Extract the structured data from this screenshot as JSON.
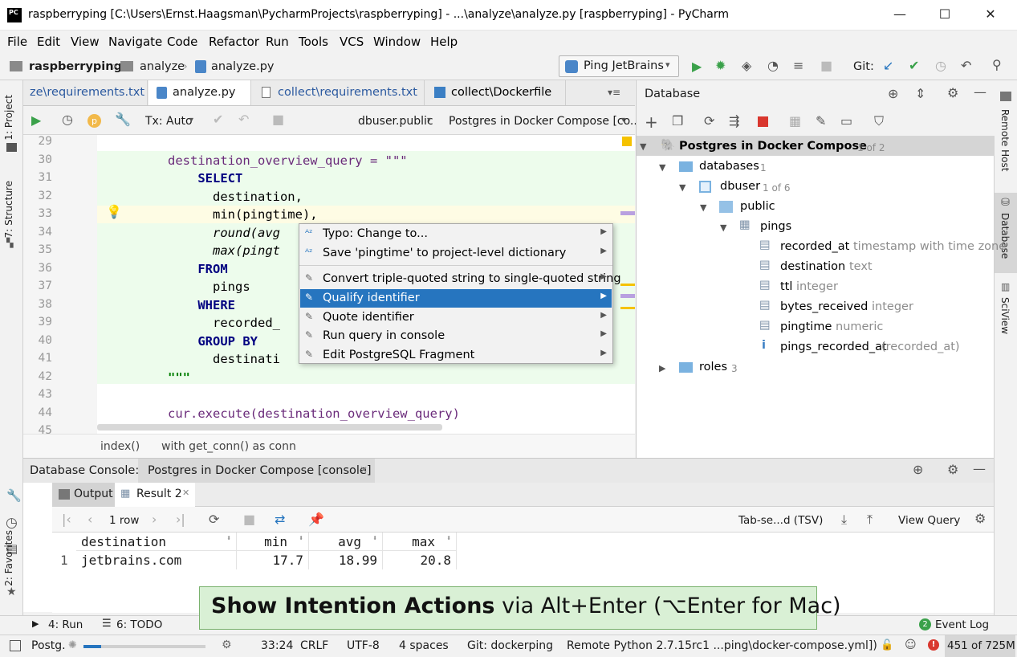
{
  "window": {
    "title": "raspberryping [C:\\Users\\Ernst.Haagsman\\PycharmProjects\\raspberryping] - ...\\analyze\\analyze.py [raspberryping] - PyCharm",
    "logo": "PC"
  },
  "menu": [
    "File",
    "Edit",
    "View",
    "Navigate",
    "Code",
    "Refactor",
    "Run",
    "Tools",
    "VCS",
    "Window",
    "Help"
  ],
  "nav": {
    "project": "raspberryping",
    "folder": "analyze",
    "file": "analyze.py",
    "run_config": "Ping JetBrains",
    "git_label": "Git:"
  },
  "editor_tabs": [
    {
      "label": "ze\\requirements.txt"
    },
    {
      "label": "analyze.py"
    },
    {
      "label": "collect\\requirements.txt"
    },
    {
      "label": "collect\\Dockerfile"
    }
  ],
  "editor_toolbar": {
    "tx": "Tx: Auto",
    "schema": "dbuser.public",
    "datasource": "Postgres in Docker Compose [co..."
  },
  "code": {
    "line_numbers": [
      "29",
      "30",
      "31",
      "32",
      "33",
      "34",
      "35",
      "36",
      "37",
      "38",
      "39",
      "40",
      "41",
      "42",
      "43",
      "44",
      "45"
    ],
    "lines": [
      "",
      "destination_overview_query = \"\"\"",
      "    SELECT",
      "      destination,",
      "      min(pingtime),",
      "      round(avg",
      "      max(pingt",
      "    FROM",
      "      pings",
      "    WHERE",
      "      recorded_",
      "    GROUP BY",
      "      destinati",
      "\"\"\"",
      "",
      "cur.execute(destination_overview_query)",
      ""
    ]
  },
  "intention_popup": {
    "items": [
      "Typo: Change to...",
      "Save 'pingtime' to project-level dictionary",
      "Convert triple-quoted string to single-quoted string",
      "Qualify identifier",
      "Quote identifier",
      "Run query in console",
      "Edit PostgreSQL Fragment"
    ],
    "selected": "Qualify identifier"
  },
  "editor_breadcrumbs": [
    "index()",
    "with get_conn() as conn"
  ],
  "database": {
    "title": "Database",
    "root": {
      "label": "Postgres in Docker Compose",
      "count": "1 of 2"
    },
    "databases": {
      "label": "databases",
      "count": "1"
    },
    "dbuser": {
      "label": "dbuser",
      "count": "1 of 6"
    },
    "schema": "public",
    "table": "pings",
    "columns": [
      {
        "name": "recorded_at",
        "type": "timestamp with time zone"
      },
      {
        "name": "destination",
        "type": "text"
      },
      {
        "name": "ttl",
        "type": "integer"
      },
      {
        "name": "bytes_received",
        "type": "integer"
      },
      {
        "name": "pingtime",
        "type": "numeric"
      }
    ],
    "index": {
      "name": "pings_recorded_at",
      "detail": "(recorded_at)"
    },
    "roles": {
      "label": "roles",
      "count": "3"
    }
  },
  "console": {
    "label": "Database Console:",
    "tab": "Postgres in Docker Compose [console]",
    "subtabs": [
      "Output",
      "Result 2"
    ],
    "rows_label": "1 row",
    "format": "Tab-se...d (TSV)",
    "view_query": "View Query",
    "columns": [
      "destination",
      "min",
      "avg",
      "max"
    ],
    "rows": [
      {
        "num": "1",
        "destination": "jetbrains.com",
        "min": "17.7",
        "avg": "18.99",
        "max": "20.8"
      }
    ]
  },
  "banner": {
    "bold": "Show Intention Actions",
    "rest": " via Alt+Enter (⌥Enter for Mac)"
  },
  "bottom_tabs": {
    "run": "4: Run",
    "todo": "6: TODO",
    "event_log": "Event Log",
    "event_count": "2"
  },
  "left_tabs": [
    "1: Project",
    "7: Structure",
    "2: Favorites"
  ],
  "right_tabs": [
    "Remote Host",
    "Database",
    "SciView"
  ],
  "status": {
    "task": "Postg.",
    "position": "33:24",
    "line_sep": "CRLF",
    "encoding": "UTF-8",
    "indent": "4 spaces",
    "git": "Git: dockerping",
    "interpreter": "Remote Python 2.7.15rc1 ...ping\\docker-compose.yml])",
    "memory": "451 of 725M"
  }
}
